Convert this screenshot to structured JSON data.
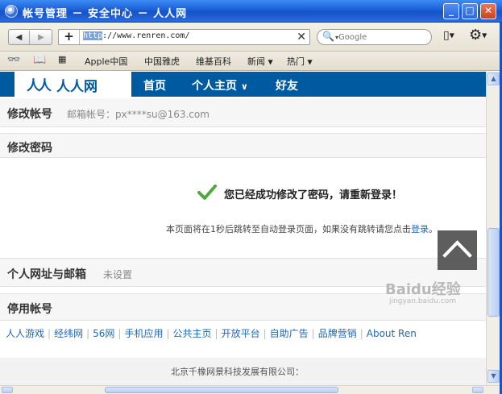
{
  "window": {
    "title": "帐号管理 － 安全中心 － 人人网",
    "minimize_label": "_",
    "maximize_label": "□",
    "close_label": "✕"
  },
  "toolbar": {
    "back_label": "◀",
    "forward_label": "▶",
    "add_label": "+",
    "url_highlight": "http",
    "url_rest": "://www.renren.com/",
    "clear_label": "✕",
    "search_placeholder": "Google",
    "search_icon": "search-icon",
    "page_icon": "page-icon",
    "gear_icon": "gear-icon"
  },
  "bookmarks": {
    "items": [
      "Apple中国",
      "中国雅虎",
      "维基百科",
      "新闻",
      "热门"
    ]
  },
  "site": {
    "logo_mark": "人人",
    "logo_name": "人人网",
    "nav": [
      "首页",
      "个人主页",
      "好友"
    ],
    "brand_color": "#005aa0"
  },
  "account": {
    "modify_account_label": "修改帐号",
    "email_info": "邮箱帐号：px****su@163.com",
    "modify_password_label": "修改密码",
    "success_message": "您已经成功修改了密码，请重新登录！",
    "redirect_text": "本页面将在1秒后跳转至自动登录页面，如果没有跳转请您点击",
    "login_link": "登录",
    "redirect_end": "。",
    "url_email_label": "个人网址与邮箱",
    "url_email_value": "未设置",
    "disable_label": "停用帐号"
  },
  "footer": {
    "links": [
      "人人游戏",
      "经纬网",
      "56网",
      "手机应用",
      "公共主页",
      "开放平台",
      "自助广告",
      "品牌营销",
      "About Ren"
    ],
    "company": "北京千橡网景科技发展有限公司："
  },
  "watermark": {
    "main": "Baidu经验",
    "sub": "jingyan.baidu.com"
  }
}
